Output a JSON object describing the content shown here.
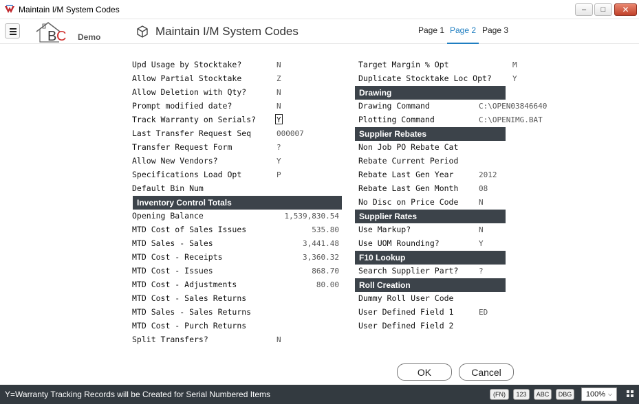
{
  "window": {
    "title": "Maintain I/M System Codes"
  },
  "header": {
    "logo_demo": "Demo",
    "form_title": "Maintain I/M System Codes",
    "tabs": [
      {
        "label": "Page 1",
        "active": false
      },
      {
        "label": "Page 2",
        "active": true
      },
      {
        "label": "Page 3",
        "active": false
      }
    ]
  },
  "left": {
    "fields": [
      {
        "label": "Upd Usage by Stocktake?",
        "value": "N"
      },
      {
        "label": "Allow Partial Stocktake",
        "value": "Z"
      },
      {
        "label": "Allow Deletion with Qty?",
        "value": "N"
      },
      {
        "label": "Prompt modified date?",
        "value": "N"
      },
      {
        "label": "Track Warranty on Serials?",
        "value": "Y"
      },
      {
        "label": "Last Transfer Request Seq",
        "value": "000007"
      },
      {
        "label": "Transfer Request Form",
        "value": "?"
      },
      {
        "label": "Allow New Vendors?",
        "value": "Y"
      },
      {
        "label": "Specifications Load Opt",
        "value": "P"
      },
      {
        "label": "Default Bin Num",
        "value": ""
      }
    ],
    "inventory_section": "Inventory Control Totals",
    "totals": [
      {
        "label": "Opening Balance",
        "value": "1,539,830.54"
      },
      {
        "label": "MTD Cost of Sales Issues",
        "value": "535.80"
      },
      {
        "label": "MTD Sales - Sales",
        "value": "3,441.48"
      },
      {
        "label": "MTD Cost - Receipts",
        "value": "3,360.32"
      },
      {
        "label": "MTD Cost - Issues",
        "value": "868.70"
      },
      {
        "label": "MTD Cost - Adjustments",
        "value": "80.00"
      },
      {
        "label": "MTD Cost - Sales Returns",
        "value": ""
      },
      {
        "label": "MTD Sales - Sales Returns",
        "value": ""
      },
      {
        "label": "MTD Cost - Purch Returns",
        "value": ""
      }
    ],
    "split_transfers": {
      "label": "Split Transfers?",
      "value": "N"
    }
  },
  "right": {
    "top": [
      {
        "label": "Target Margin % Opt",
        "value": "M"
      },
      {
        "label": "Duplicate Stocktake Loc Opt?",
        "value": "Y"
      }
    ],
    "drawing": {
      "title": "Drawing",
      "fields": [
        {
          "label": "Drawing Command",
          "value": "C:\\OPEN03846640"
        },
        {
          "label": "Plotting Command",
          "value": "C:\\OPENIMG.BAT"
        }
      ]
    },
    "supplier_rebates": {
      "title": "Supplier Rebates",
      "fields": [
        {
          "label": "Non Job PO Rebate Cat",
          "value": ""
        },
        {
          "label": "Rebate Current Period",
          "value": ""
        },
        {
          "label": "Rebate Last Gen Year",
          "value": "2012"
        },
        {
          "label": "Rebate Last Gen Month",
          "value": "08"
        },
        {
          "label": "No Disc on Price Code",
          "value": "N"
        }
      ]
    },
    "supplier_rates": {
      "title": "Supplier Rates",
      "fields": [
        {
          "label": "Use Markup?",
          "value": "N"
        },
        {
          "label": "Use UOM Rounding?",
          "value": "Y"
        }
      ]
    },
    "f10_lookup": {
      "title": "F10 Lookup",
      "fields": [
        {
          "label": "Search Supplier Part?",
          "value": "?"
        }
      ]
    },
    "roll_creation": {
      "title": "Roll Creation",
      "fields": [
        {
          "label": "Dummy Roll User Code",
          "value": ""
        },
        {
          "label": "User Defined Field 1",
          "value": "ED"
        },
        {
          "label": "User Defined Field 2",
          "value": ""
        }
      ]
    }
  },
  "buttons": {
    "ok": "OK",
    "cancel": "Cancel"
  },
  "status": {
    "message": "Y=Warranty Tracking Records will be Created for Serial Numbered Items",
    "chips": [
      "(FN)",
      "123",
      "ABC",
      "DBG"
    ],
    "zoom": "100%"
  }
}
